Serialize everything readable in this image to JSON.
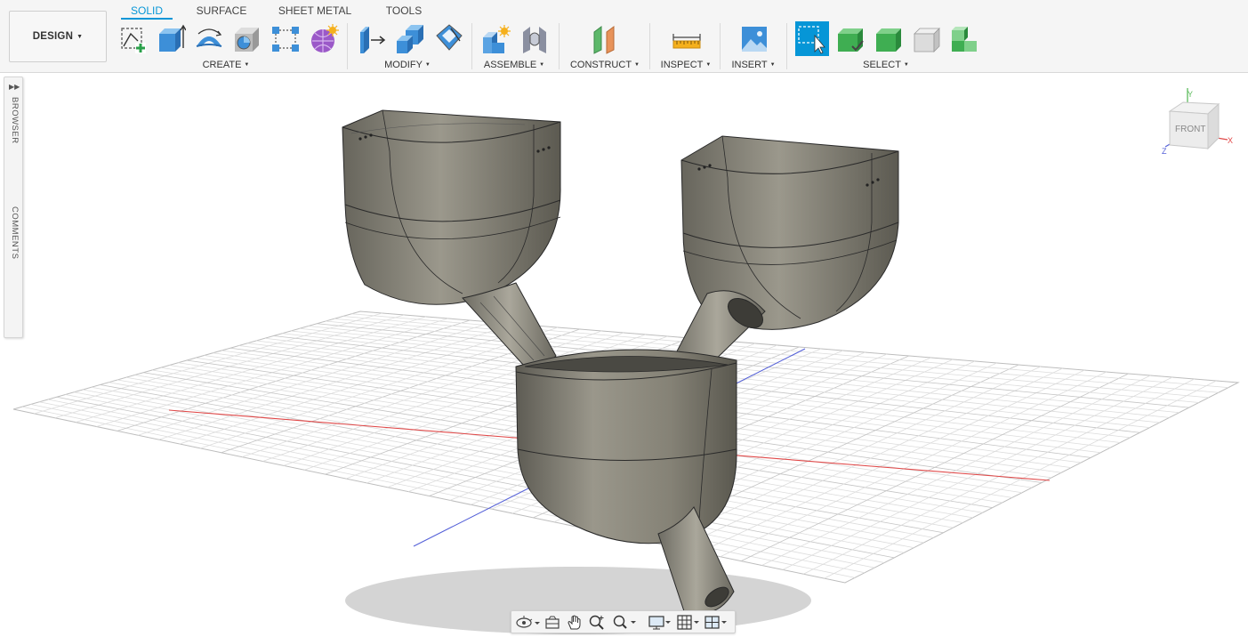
{
  "workspace": {
    "label": "DESIGN"
  },
  "tabs": [
    {
      "label": "SOLID",
      "active": true
    },
    {
      "label": "SURFACE",
      "active": false
    },
    {
      "label": "SHEET METAL",
      "active": false
    },
    {
      "label": "TOOLS",
      "active": false
    }
  ],
  "groups": {
    "create": "CREATE",
    "modify": "MODIFY",
    "assemble": "ASSEMBLE",
    "construct": "CONSTRUCT",
    "inspect": "INSPECT",
    "insert": "INSERT",
    "select": "SELECT"
  },
  "side_panel": {
    "browser": "BROWSER",
    "comments": "COMMENTS"
  },
  "viewcube": {
    "face": "FRONT",
    "x_axis": "X",
    "y_axis": "Y",
    "z_axis": "Z"
  },
  "icons": {
    "create": [
      "create-sketch-icon",
      "extrude-icon",
      "revolve-icon",
      "hole-icon",
      "pattern-icon",
      "create-form-icon"
    ],
    "modify": [
      "press-pull-icon",
      "combine-icon",
      "shell-icon"
    ],
    "assemble": [
      "new-component-icon",
      "joint-icon"
    ],
    "construct": [
      "offset-plane-icon"
    ],
    "inspect": [
      "measure-icon"
    ],
    "insert": [
      "insert-image-icon"
    ],
    "select": [
      "window-select-icon",
      "select-body-icon",
      "select-face-icon",
      "select-component-icon",
      "select-priority-icon"
    ],
    "navigation": [
      "orbit-icon",
      "look-at-icon",
      "pan-icon",
      "zoom-icon",
      "fit-icon",
      "display-settings-icon",
      "grid-settings-icon",
      "viewports-icon"
    ]
  },
  "colors": {
    "accent": "#0696d7",
    "body_fill": "#868377",
    "x_axis": "#e04848",
    "z_axis": "#5561d8",
    "grid": "#d7d7d7"
  }
}
